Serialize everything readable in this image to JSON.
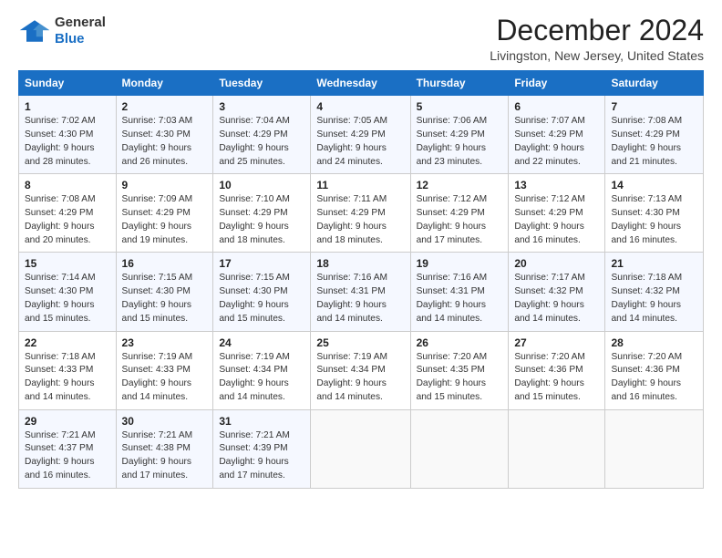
{
  "logo": {
    "general": "General",
    "blue": "Blue"
  },
  "title": "December 2024",
  "location": "Livingston, New Jersey, United States",
  "days_of_week": [
    "Sunday",
    "Monday",
    "Tuesday",
    "Wednesday",
    "Thursday",
    "Friday",
    "Saturday"
  ],
  "weeks": [
    [
      {
        "day": 1,
        "sunrise": "Sunrise: 7:02 AM",
        "sunset": "Sunset: 4:30 PM",
        "daylight": "Daylight: 9 hours and 28 minutes."
      },
      {
        "day": 2,
        "sunrise": "Sunrise: 7:03 AM",
        "sunset": "Sunset: 4:30 PM",
        "daylight": "Daylight: 9 hours and 26 minutes."
      },
      {
        "day": 3,
        "sunrise": "Sunrise: 7:04 AM",
        "sunset": "Sunset: 4:29 PM",
        "daylight": "Daylight: 9 hours and 25 minutes."
      },
      {
        "day": 4,
        "sunrise": "Sunrise: 7:05 AM",
        "sunset": "Sunset: 4:29 PM",
        "daylight": "Daylight: 9 hours and 24 minutes."
      },
      {
        "day": 5,
        "sunrise": "Sunrise: 7:06 AM",
        "sunset": "Sunset: 4:29 PM",
        "daylight": "Daylight: 9 hours and 23 minutes."
      },
      {
        "day": 6,
        "sunrise": "Sunrise: 7:07 AM",
        "sunset": "Sunset: 4:29 PM",
        "daylight": "Daylight: 9 hours and 22 minutes."
      },
      {
        "day": 7,
        "sunrise": "Sunrise: 7:08 AM",
        "sunset": "Sunset: 4:29 PM",
        "daylight": "Daylight: 9 hours and 21 minutes."
      }
    ],
    [
      {
        "day": 8,
        "sunrise": "Sunrise: 7:08 AM",
        "sunset": "Sunset: 4:29 PM",
        "daylight": "Daylight: 9 hours and 20 minutes."
      },
      {
        "day": 9,
        "sunrise": "Sunrise: 7:09 AM",
        "sunset": "Sunset: 4:29 PM",
        "daylight": "Daylight: 9 hours and 19 minutes."
      },
      {
        "day": 10,
        "sunrise": "Sunrise: 7:10 AM",
        "sunset": "Sunset: 4:29 PM",
        "daylight": "Daylight: 9 hours and 18 minutes."
      },
      {
        "day": 11,
        "sunrise": "Sunrise: 7:11 AM",
        "sunset": "Sunset: 4:29 PM",
        "daylight": "Daylight: 9 hours and 18 minutes."
      },
      {
        "day": 12,
        "sunrise": "Sunrise: 7:12 AM",
        "sunset": "Sunset: 4:29 PM",
        "daylight": "Daylight: 9 hours and 17 minutes."
      },
      {
        "day": 13,
        "sunrise": "Sunrise: 7:12 AM",
        "sunset": "Sunset: 4:29 PM",
        "daylight": "Daylight: 9 hours and 16 minutes."
      },
      {
        "day": 14,
        "sunrise": "Sunrise: 7:13 AM",
        "sunset": "Sunset: 4:30 PM",
        "daylight": "Daylight: 9 hours and 16 minutes."
      }
    ],
    [
      {
        "day": 15,
        "sunrise": "Sunrise: 7:14 AM",
        "sunset": "Sunset: 4:30 PM",
        "daylight": "Daylight: 9 hours and 15 minutes."
      },
      {
        "day": 16,
        "sunrise": "Sunrise: 7:15 AM",
        "sunset": "Sunset: 4:30 PM",
        "daylight": "Daylight: 9 hours and 15 minutes."
      },
      {
        "day": 17,
        "sunrise": "Sunrise: 7:15 AM",
        "sunset": "Sunset: 4:30 PM",
        "daylight": "Daylight: 9 hours and 15 minutes."
      },
      {
        "day": 18,
        "sunrise": "Sunrise: 7:16 AM",
        "sunset": "Sunset: 4:31 PM",
        "daylight": "Daylight: 9 hours and 14 minutes."
      },
      {
        "day": 19,
        "sunrise": "Sunrise: 7:16 AM",
        "sunset": "Sunset: 4:31 PM",
        "daylight": "Daylight: 9 hours and 14 minutes."
      },
      {
        "day": 20,
        "sunrise": "Sunrise: 7:17 AM",
        "sunset": "Sunset: 4:32 PM",
        "daylight": "Daylight: 9 hours and 14 minutes."
      },
      {
        "day": 21,
        "sunrise": "Sunrise: 7:18 AM",
        "sunset": "Sunset: 4:32 PM",
        "daylight": "Daylight: 9 hours and 14 minutes."
      }
    ],
    [
      {
        "day": 22,
        "sunrise": "Sunrise: 7:18 AM",
        "sunset": "Sunset: 4:33 PM",
        "daylight": "Daylight: 9 hours and 14 minutes."
      },
      {
        "day": 23,
        "sunrise": "Sunrise: 7:19 AM",
        "sunset": "Sunset: 4:33 PM",
        "daylight": "Daylight: 9 hours and 14 minutes."
      },
      {
        "day": 24,
        "sunrise": "Sunrise: 7:19 AM",
        "sunset": "Sunset: 4:34 PM",
        "daylight": "Daylight: 9 hours and 14 minutes."
      },
      {
        "day": 25,
        "sunrise": "Sunrise: 7:19 AM",
        "sunset": "Sunset: 4:34 PM",
        "daylight": "Daylight: 9 hours and 14 minutes."
      },
      {
        "day": 26,
        "sunrise": "Sunrise: 7:20 AM",
        "sunset": "Sunset: 4:35 PM",
        "daylight": "Daylight: 9 hours and 15 minutes."
      },
      {
        "day": 27,
        "sunrise": "Sunrise: 7:20 AM",
        "sunset": "Sunset: 4:36 PM",
        "daylight": "Daylight: 9 hours and 15 minutes."
      },
      {
        "day": 28,
        "sunrise": "Sunrise: 7:20 AM",
        "sunset": "Sunset: 4:36 PM",
        "daylight": "Daylight: 9 hours and 16 minutes."
      }
    ],
    [
      {
        "day": 29,
        "sunrise": "Sunrise: 7:21 AM",
        "sunset": "Sunset: 4:37 PM",
        "daylight": "Daylight: 9 hours and 16 minutes."
      },
      {
        "day": 30,
        "sunrise": "Sunrise: 7:21 AM",
        "sunset": "Sunset: 4:38 PM",
        "daylight": "Daylight: 9 hours and 17 minutes."
      },
      {
        "day": 31,
        "sunrise": "Sunrise: 7:21 AM",
        "sunset": "Sunset: 4:39 PM",
        "daylight": "Daylight: 9 hours and 17 minutes."
      },
      null,
      null,
      null,
      null
    ]
  ],
  "colors": {
    "header_bg": "#1a6fc4",
    "header_text": "#ffffff",
    "accent_blue": "#1a6fc4"
  }
}
